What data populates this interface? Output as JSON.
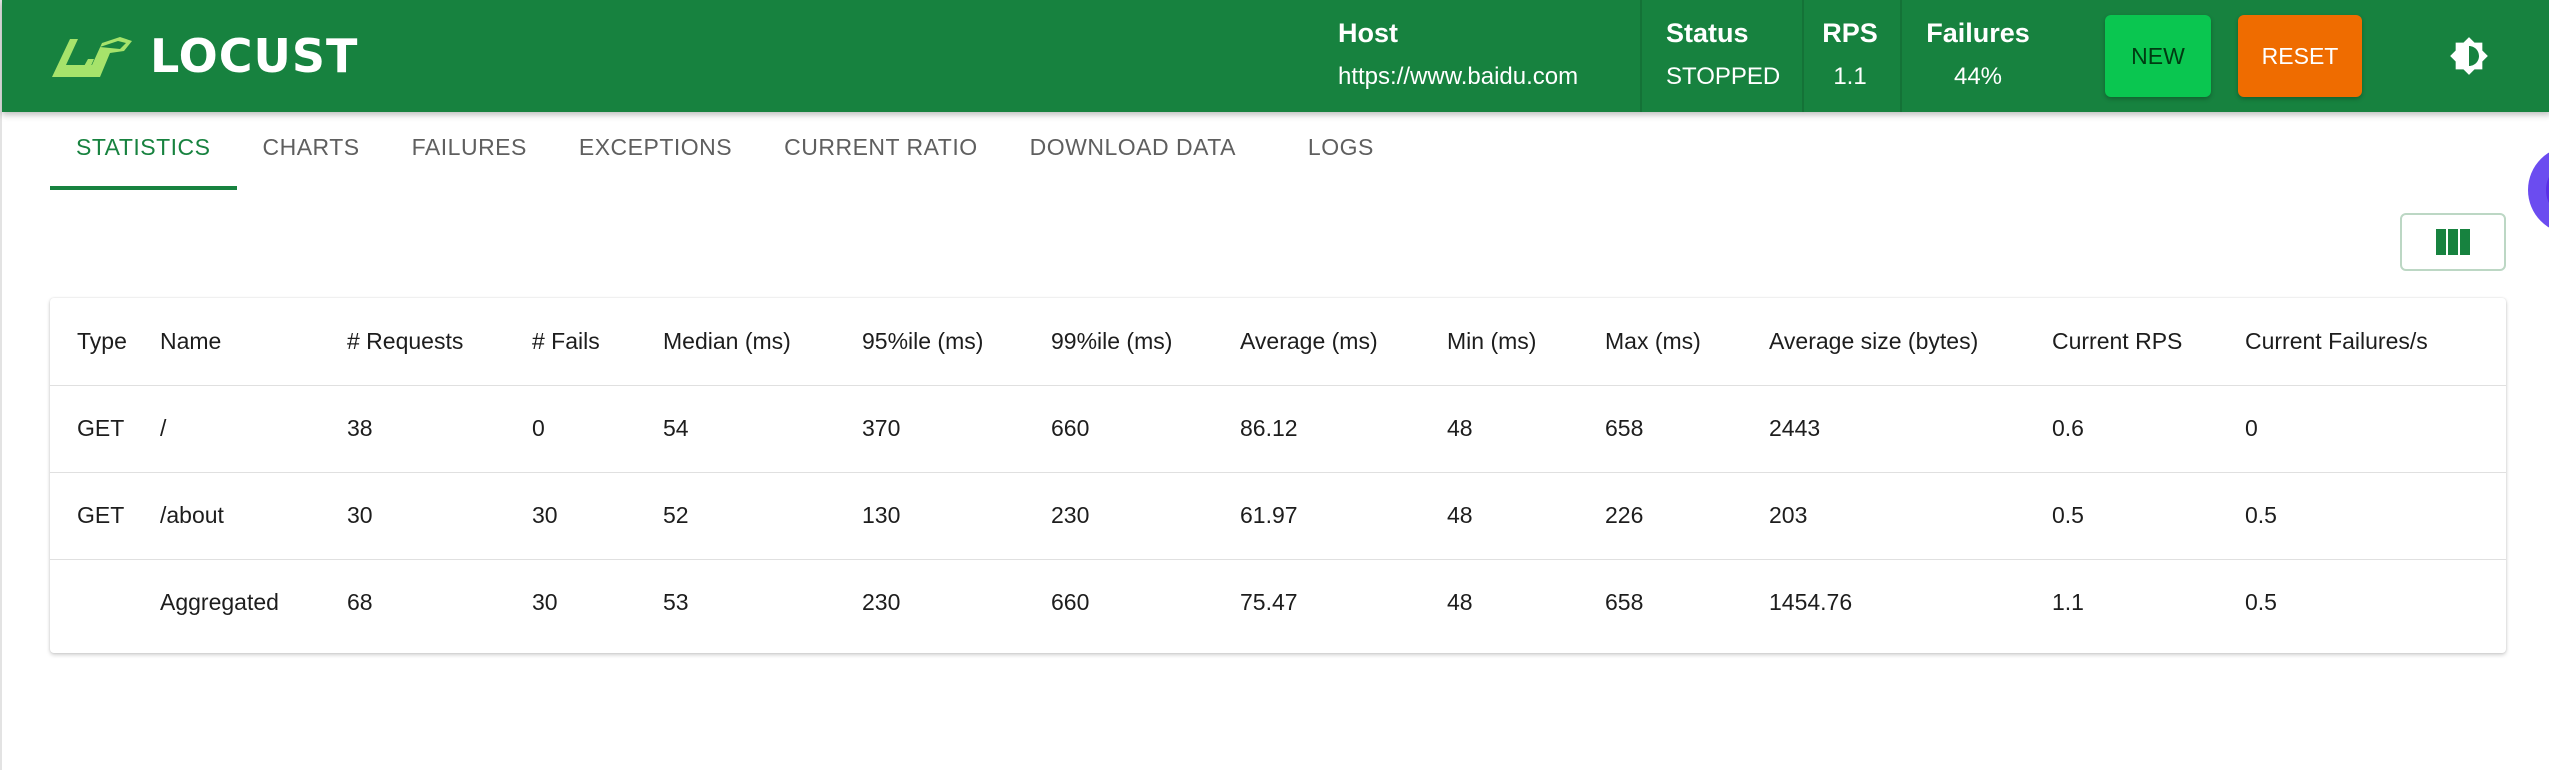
{
  "header": {
    "logo_text": "LOCUST",
    "host_label": "Host",
    "host_value": "https://www.baidu.com",
    "status_label": "Status",
    "status_value": "STOPPED",
    "rps_label": "RPS",
    "rps_value": "1.1",
    "failures_label": "Failures",
    "failures_value": "44%",
    "new_button": "NEW",
    "reset_button": "RESET"
  },
  "tabs": [
    {
      "label": "STATISTICS",
      "active": true
    },
    {
      "label": "CHARTS"
    },
    {
      "label": "FAILURES"
    },
    {
      "label": "EXCEPTIONS"
    },
    {
      "label": "CURRENT RATIO"
    },
    {
      "label": "DOWNLOAD DATA"
    },
    {
      "label": "LOGS"
    }
  ],
  "table": {
    "columns": [
      "Type",
      "Name",
      "# Requests",
      "# Fails",
      "Median (ms)",
      "95%ile (ms)",
      "99%ile (ms)",
      "Average (ms)",
      "Min (ms)",
      "Max (ms)",
      "Average size (bytes)",
      "Current RPS",
      "Current Failures/s"
    ],
    "rows": [
      [
        "GET",
        "/",
        "38",
        "0",
        "54",
        "370",
        "660",
        "86.12",
        "48",
        "658",
        "2443",
        "0.6",
        "0"
      ],
      [
        "GET",
        "/about",
        "30",
        "30",
        "52",
        "130",
        "230",
        "61.97",
        "48",
        "226",
        "203",
        "0.5",
        "0.5"
      ],
      [
        "",
        "Aggregated",
        "68",
        "30",
        "53",
        "230",
        "660",
        "75.47",
        "48",
        "658",
        "1454.76",
        "1.1",
        "0.5"
      ]
    ]
  },
  "colors": {
    "header_bg": "#17823f",
    "new_button": "#0ac650",
    "reset_button": "#ef6c00",
    "active_tab": "#17823f"
  },
  "icons": {
    "logo": "grasshopper-logo-icon",
    "theme": "brightness-icon",
    "columns": "view-column-icon"
  }
}
